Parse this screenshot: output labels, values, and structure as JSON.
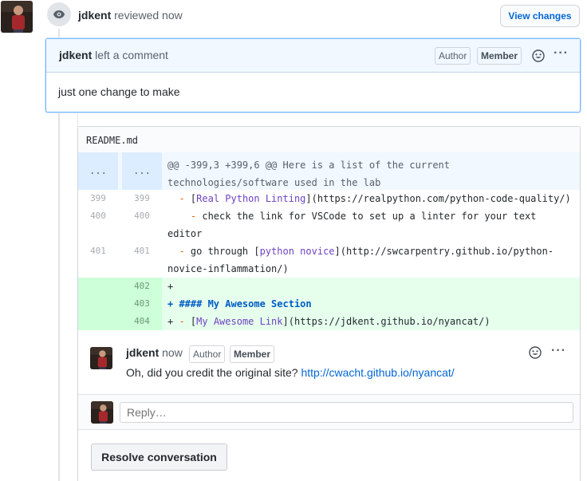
{
  "review": {
    "author": "jdkent",
    "action": "reviewed now",
    "view_changes_label": "View changes"
  },
  "comment": {
    "author": "jdkent",
    "action": "left a comment",
    "badge_author": "Author",
    "badge_member": "Member",
    "body": "just one change to make"
  },
  "file": {
    "name": "README.md",
    "hunk_left": "...",
    "hunk_right": "...",
    "hunk_header": "@@ -399,3 +399,6 @@ Here is a list of the current technologies/software used in the lab",
    "lines": [
      {
        "old": "399",
        "new": "399",
        "dash": "  - ",
        "open": "[",
        "link": "Real Python Linting",
        "close": "](https://realpython.com/python-code-quality/)"
      },
      {
        "old": "400",
        "new": "400",
        "dash": "    - ",
        "text": "check the link for VSCode to set up a linter for your text editor"
      },
      {
        "old": "401",
        "new": "401",
        "dash": "  - ",
        "text1": "go through [",
        "link": "python novice",
        "close": "](http://swcarpentry.github.io/python-novice-inflammation/)"
      },
      {
        "new": "402",
        "text": "+"
      },
      {
        "new": "403",
        "text": "+ #### My Awesome Section"
      },
      {
        "new": "404",
        "plus": "+ ",
        "dash": "- ",
        "open": "[",
        "link": "My Awesome Link",
        "close": "](https://jdkent.github.io/nyancat/)"
      }
    ]
  },
  "reply": {
    "author": "jdkent",
    "time": "now",
    "badge_author": "Author",
    "badge_member": "Member",
    "text": "Oh, did you credit the original site?",
    "link": "http://cwacht.github.io/nyancat/",
    "input_placeholder": "Reply…"
  },
  "resolve_label": "Resolve conversation",
  "colors": {
    "link": "#0366d6",
    "addition_bg": "#e6ffed",
    "hunk_bg": "#f1f8ff"
  }
}
